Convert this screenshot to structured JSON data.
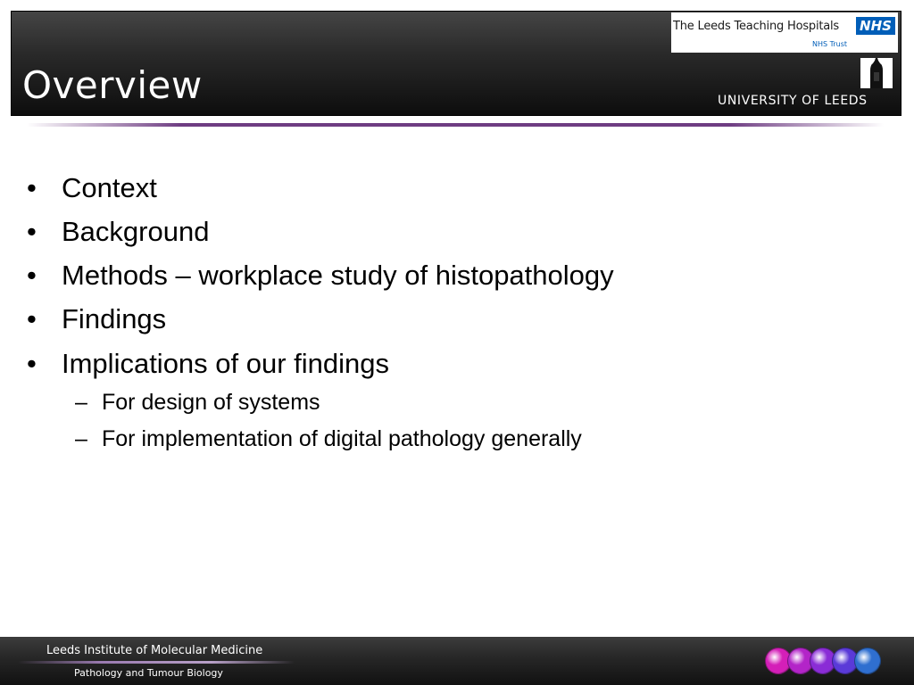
{
  "slide": {
    "title": "Overview",
    "bullets": [
      {
        "label": "Context"
      },
      {
        "label": "Background"
      },
      {
        "label": "Methods – workplace study of histopathology"
      },
      {
        "label": "Findings"
      },
      {
        "label": "Implications of our findings"
      }
    ],
    "sub_bullets": [
      {
        "label": "For design of systems"
      },
      {
        "label": "For implementation of digital pathology generally"
      }
    ],
    "bullet_mark": "•",
    "sub_bullet_mark": "–"
  },
  "logos": {
    "nhs_org": "The Leeds Teaching Hospitals",
    "nhs_badge": "NHS",
    "nhs_trust": "NHS Trust",
    "university": "UNIVERSITY OF LEEDS"
  },
  "footer": {
    "institute": "Leeds Institute of Molecular Medicine",
    "department": "Pathology and Tumour Biology",
    "dot_colors": [
      "#d41fb8",
      "#b324c8",
      "#8a2cd6",
      "#5a3ad8",
      "#2f6fd0"
    ]
  },
  "colors": {
    "header_bg": "#1a1a1a",
    "accent_purple": "#6e3c82",
    "nhs_blue": "#005eb8",
    "text": "#000000"
  }
}
